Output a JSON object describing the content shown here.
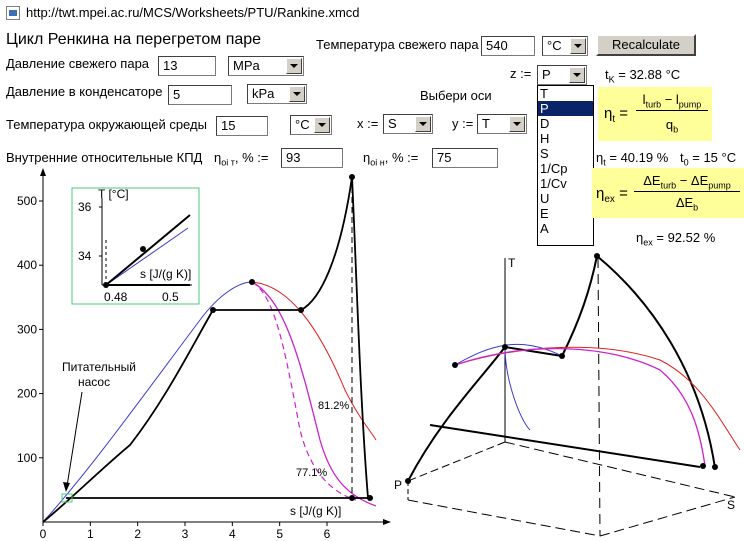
{
  "address": {
    "url": "http://twt.mpei.ac.ru/MCS/Worksheets/PTU/Rankine.xmcd"
  },
  "header": {
    "title": "Цикл Ренкина на перегретом паре"
  },
  "inputs": {
    "live_steam_temp": {
      "label": "Температура свежего пара",
      "value": "540",
      "unit": "°C"
    },
    "live_steam_pressure": {
      "label": "Давление свежего пара",
      "value": "13",
      "unit": "MPa"
    },
    "condenser_pressure": {
      "label": "Давление в конденсаторе",
      "value": "5",
      "unit": "kPa"
    },
    "ambient_temp": {
      "label": "Температура окружающей среды",
      "value": "15",
      "unit": "°C"
    },
    "efficiency_label": "Внутренние относительные КПД",
    "eta_turbine": {
      "label": "η",
      "sub": "oi т",
      "suffix": ", % :=",
      "value": "93"
    },
    "eta_pump": {
      "label": "η",
      "sub": "oi н",
      "suffix": ", % :=",
      "value": "75"
    },
    "recalc_label": "Recalculate"
  },
  "axes_select": {
    "label": "Выбери оси",
    "x_label": "x :=",
    "x_value": "S",
    "y_label": "y :=",
    "y_value": "T",
    "z_label": "z :=",
    "z_value": "P",
    "z_options": [
      "T",
      "P",
      "D",
      "H",
      "S",
      "1/Cp",
      "1/Cv",
      "U",
      "E",
      "A"
    ],
    "z_selected_index": 1
  },
  "results": {
    "tk": "t",
    "tk_sub": "K",
    "tk_value": " = 32.88 °C",
    "eta_t_symbol": "η",
    "eta_t_sub": "t",
    "eta_t_num": "l",
    "eta_t_num_sub1": "turb",
    "eta_t_minus": " − l",
    "eta_t_num_sub2": "pump",
    "eta_t_den": "q",
    "eta_t_den_sub": "b",
    "eta_t_line": " = 40.19 %",
    "t0_line": "t",
    "t0_sub": "0",
    "t0_value": " = 15 °C",
    "eta_ex_symbol": "η",
    "eta_ex_sub": "ex",
    "eta_ex_num": "ΔE",
    "eta_ex_num_sub1": "turb",
    "eta_ex_minus": " − ΔE",
    "eta_ex_num_sub2": "pump",
    "eta_ex_den": "ΔE",
    "eta_ex_den_sub": "b",
    "eta_ex_value": " = 92.52 %"
  },
  "ts_chart_labels": {
    "y_ticks": [
      "100",
      "200",
      "300",
      "400",
      "500"
    ],
    "x_ticks": [
      "0",
      "1",
      "2",
      "3",
      "4",
      "5",
      "6"
    ],
    "x_axis": "s [J/(g K)]",
    "label_812": "81.2%",
    "label_771": "77.1%",
    "pump_label_1": "Питательный",
    "pump_label_2": "насос"
  },
  "inset": {
    "y_title": "T [°C]",
    "y_ticks": [
      "36",
      "34"
    ],
    "x_title": "s [J/(g K)]",
    "x_ticks": [
      "0.48",
      "0.5"
    ]
  },
  "chart3d_labels": {
    "t_axis": "T",
    "p_axis": "P",
    "s_axis": "S"
  },
  "chart_data": {
    "type": "line",
    "title": "",
    "xlabel": "s [J/(g K)]",
    "ylabel": "",
    "xlim": [
      0,
      7
    ],
    "ylim": [
      0,
      560
    ],
    "series": [
      {
        "name": "saturation-left",
        "x": [
          0,
          0.5,
          1,
          1.5,
          2,
          2.5,
          3,
          3.5,
          4.0,
          4.4
        ],
        "y": [
          0,
          35,
          75,
          120,
          165,
          210,
          255,
          305,
          350,
          373
        ]
      },
      {
        "name": "cycle-ideal",
        "x": [
          0.48,
          0.5,
          1,
          2,
          3,
          3.65,
          5.4,
          6.45,
          6.7,
          6.7,
          0.48
        ],
        "y": [
          33,
          35,
          75,
          165,
          255,
          330,
          330,
          540,
          300,
          33,
          33
        ]
      },
      {
        "name": "saturation-right",
        "x": [
          4.4,
          5.0,
          5.5,
          6.0,
          6.5,
          7.0
        ],
        "y": [
          373,
          340,
          290,
          230,
          170,
          120
        ]
      }
    ],
    "inset": {
      "xlim": [
        0.47,
        0.515
      ],
      "ylim": [
        33,
        37
      ],
      "points": [
        {
          "x": 0.476,
          "y": 33.2
        },
        {
          "x": 0.489,
          "y": 34.3
        }
      ]
    }
  }
}
